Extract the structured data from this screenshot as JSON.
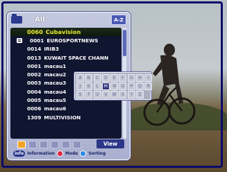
{
  "list": {
    "title": "All",
    "sort_button": "A-Z",
    "channels": [
      {
        "number": "0060",
        "name": "Cubavision",
        "selected": true,
        "locked": false
      },
      {
        "number": "0001",
        "name": "EUROSPORTNEWS",
        "selected": false,
        "locked": true
      },
      {
        "number": "0014",
        "name": "IRIB3",
        "selected": false,
        "locked": false
      },
      {
        "number": "0013",
        "name": "KUWAIT SPACE CHANN",
        "selected": false,
        "locked": false
      },
      {
        "number": "0001",
        "name": "macau1",
        "selected": false,
        "locked": false
      },
      {
        "number": "0002",
        "name": "macau2",
        "selected": false,
        "locked": false
      },
      {
        "number": "0003",
        "name": "macau3",
        "selected": false,
        "locked": false
      },
      {
        "number": "0004",
        "name": "macau4",
        "selected": false,
        "locked": false
      },
      {
        "number": "0005",
        "name": "macau5",
        "selected": false,
        "locked": false
      },
      {
        "number": "0006",
        "name": "macau6",
        "selected": false,
        "locked": false
      },
      {
        "number": "1309",
        "name": "MULTIVISION",
        "selected": false,
        "locked": false
      }
    ]
  },
  "toolbar": {
    "icons": [
      "favorite-icon",
      "delete-icon",
      "move-icon",
      "edit-icon",
      "lock-icon",
      "rename-icon"
    ],
    "view_label": "View"
  },
  "help": {
    "info_key": "info",
    "info_label": "Information",
    "mode_label": "Mode",
    "sort_label": "Sorting",
    "mode_color": "#e0263f",
    "sort_color": "#2d8be6"
  },
  "keypad": {
    "keys": [
      "A",
      "B",
      "C",
      "D",
      "E",
      "F",
      "G",
      "H",
      "I",
      "J",
      "K",
      "L",
      "M",
      "N",
      "O",
      "P",
      "Q",
      "R",
      "S",
      "T",
      "U",
      "V",
      "W",
      "X",
      "Y",
      "Z"
    ],
    "selected": "M"
  }
}
